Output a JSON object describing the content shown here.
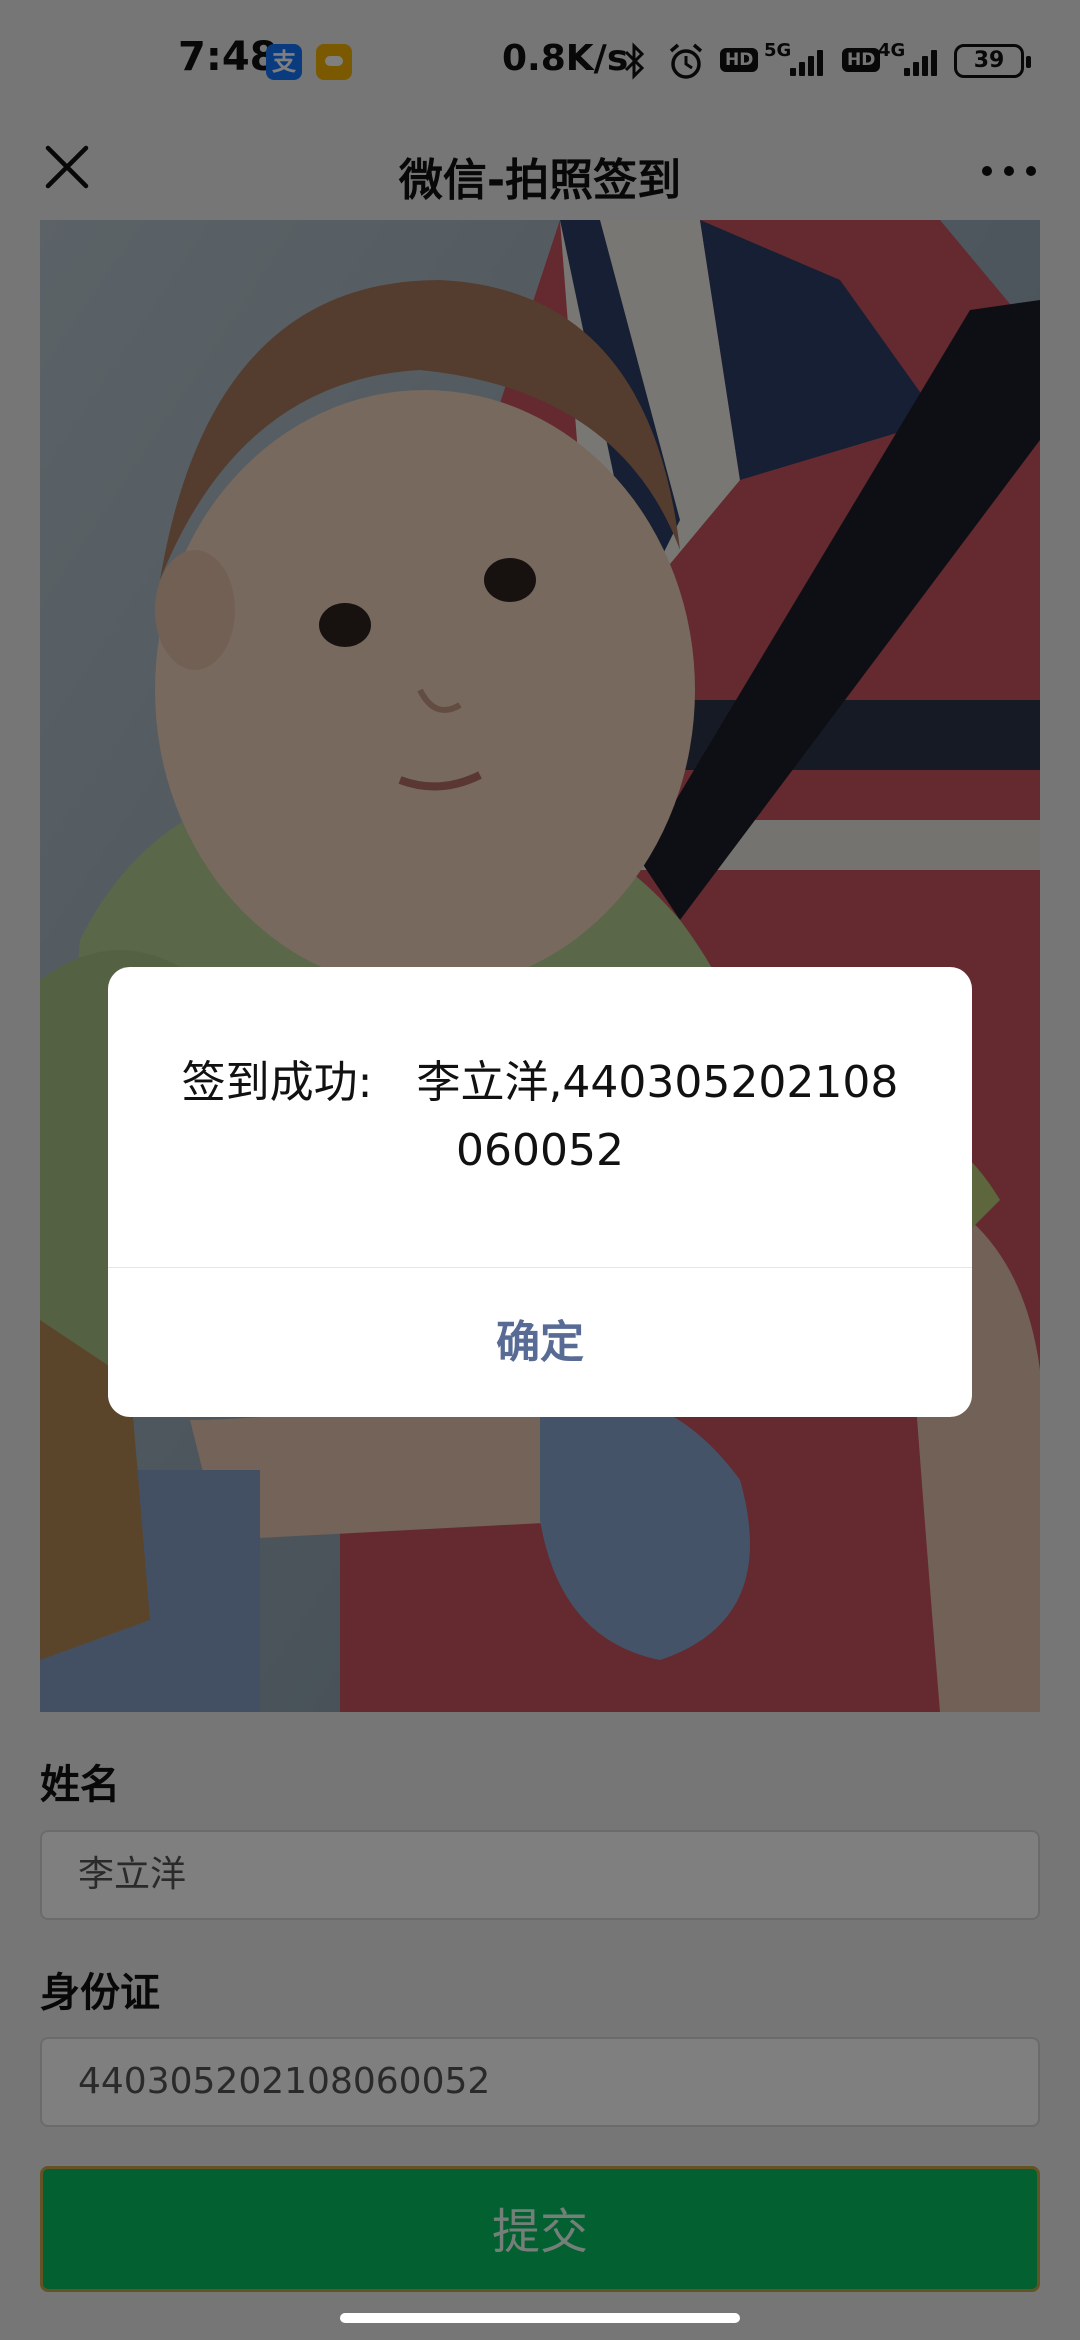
{
  "status_bar": {
    "time": "7:48",
    "app_icon_1": "支",
    "network_speed": "0.8K/s",
    "hd_badge_1": "HD",
    "network_1": "5G",
    "hd_badge_2": "HD",
    "network_2": "4G",
    "battery": "39",
    "icons": [
      "alipay-icon",
      "cloud-app-icon",
      "bluetooth-icon",
      "alarm-icon",
      "signal-icon",
      "battery-icon"
    ]
  },
  "nav": {
    "title": "微信-拍照签到",
    "close_icon": "close-icon",
    "more_icon": "more-icon"
  },
  "form": {
    "name_label": "姓名",
    "name_value": "李立洋",
    "id_label": "身份证",
    "id_value": "440305202108060052",
    "submit_label": "提交"
  },
  "dialog": {
    "message": "签到成功:　李立洋,440305202108060052",
    "confirm_label": "确定"
  },
  "colors": {
    "accent": "#07c160",
    "dialog_button": "#576b95"
  }
}
